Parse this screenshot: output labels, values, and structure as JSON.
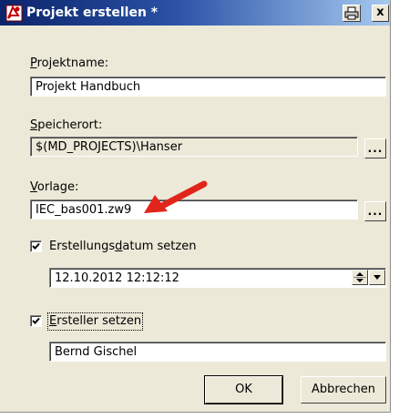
{
  "dialog": {
    "title": "Projekt erstellen *",
    "close_label": "x"
  },
  "project_name": {
    "label_underline": "P",
    "label_rest": "rojektname:",
    "value": "Projekt Handbuch"
  },
  "storage": {
    "label_underline": "S",
    "label_rest": "peicherort:",
    "value": "$(MD_PROJECTS)\\Hanser",
    "browse_label": "..."
  },
  "template": {
    "label_underline": "V",
    "label_rest": "orlage:",
    "value": "IEC_bas001.zw9",
    "browse_label": "..."
  },
  "creation_date": {
    "checkbox_label_before": "Erstellungs",
    "checkbox_label_underline": "d",
    "checkbox_label_after": "atum setzen",
    "checked": true,
    "value": "12.10.2012 12:12:12"
  },
  "creator": {
    "checkbox_label_underline": "E",
    "checkbox_label_rest": "rsteller setzen",
    "checked": true,
    "value": "Bernd Gischel"
  },
  "buttons": {
    "ok": "OK",
    "cancel": "Abbrechen"
  },
  "colors": {
    "annotation_arrow": "#e0251b",
    "title_bar": "#0a246a"
  }
}
